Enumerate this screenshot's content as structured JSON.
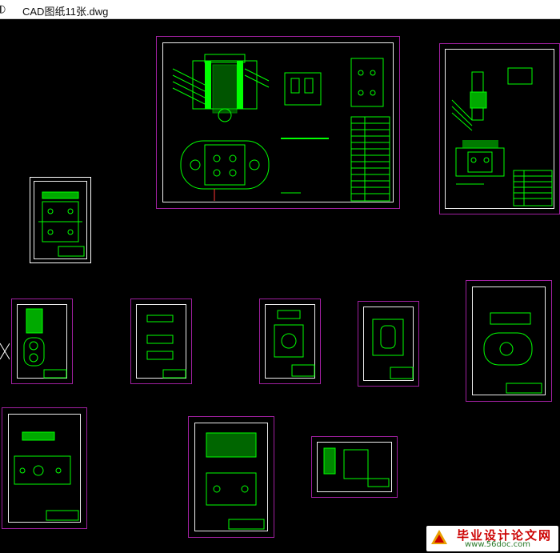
{
  "window": {
    "icon": "autocad-file-icon",
    "title": "CAD图纸11张.dwg"
  },
  "colors": {
    "background": "#000000",
    "sheet_border": "#a020a0",
    "frame_line": "#eeeeee",
    "drawing_green": "#00ff00",
    "drawing_dim": "#00c000"
  },
  "watermark": {
    "title": "毕业设计论文网",
    "url": "www.56doc.com"
  }
}
